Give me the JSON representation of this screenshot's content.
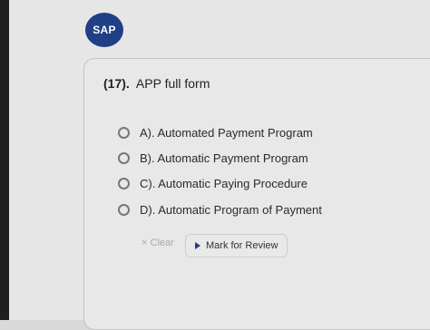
{
  "badge": {
    "text": "SAP"
  },
  "question": {
    "number": "(17).",
    "text": "APP full form"
  },
  "options": [
    {
      "label": "A). Automated Payment Program"
    },
    {
      "label": "B). Automatic Payment Program"
    },
    {
      "label": "C). Automatic Paying Procedure"
    },
    {
      "label": "D). Automatic Program of Payment"
    }
  ],
  "actions": {
    "clear_icon": "×",
    "clear_label": "Clear",
    "review_label": "Mark for Review"
  },
  "colors": {
    "accent": "#1f3f86",
    "background": "#e6e6e6"
  }
}
